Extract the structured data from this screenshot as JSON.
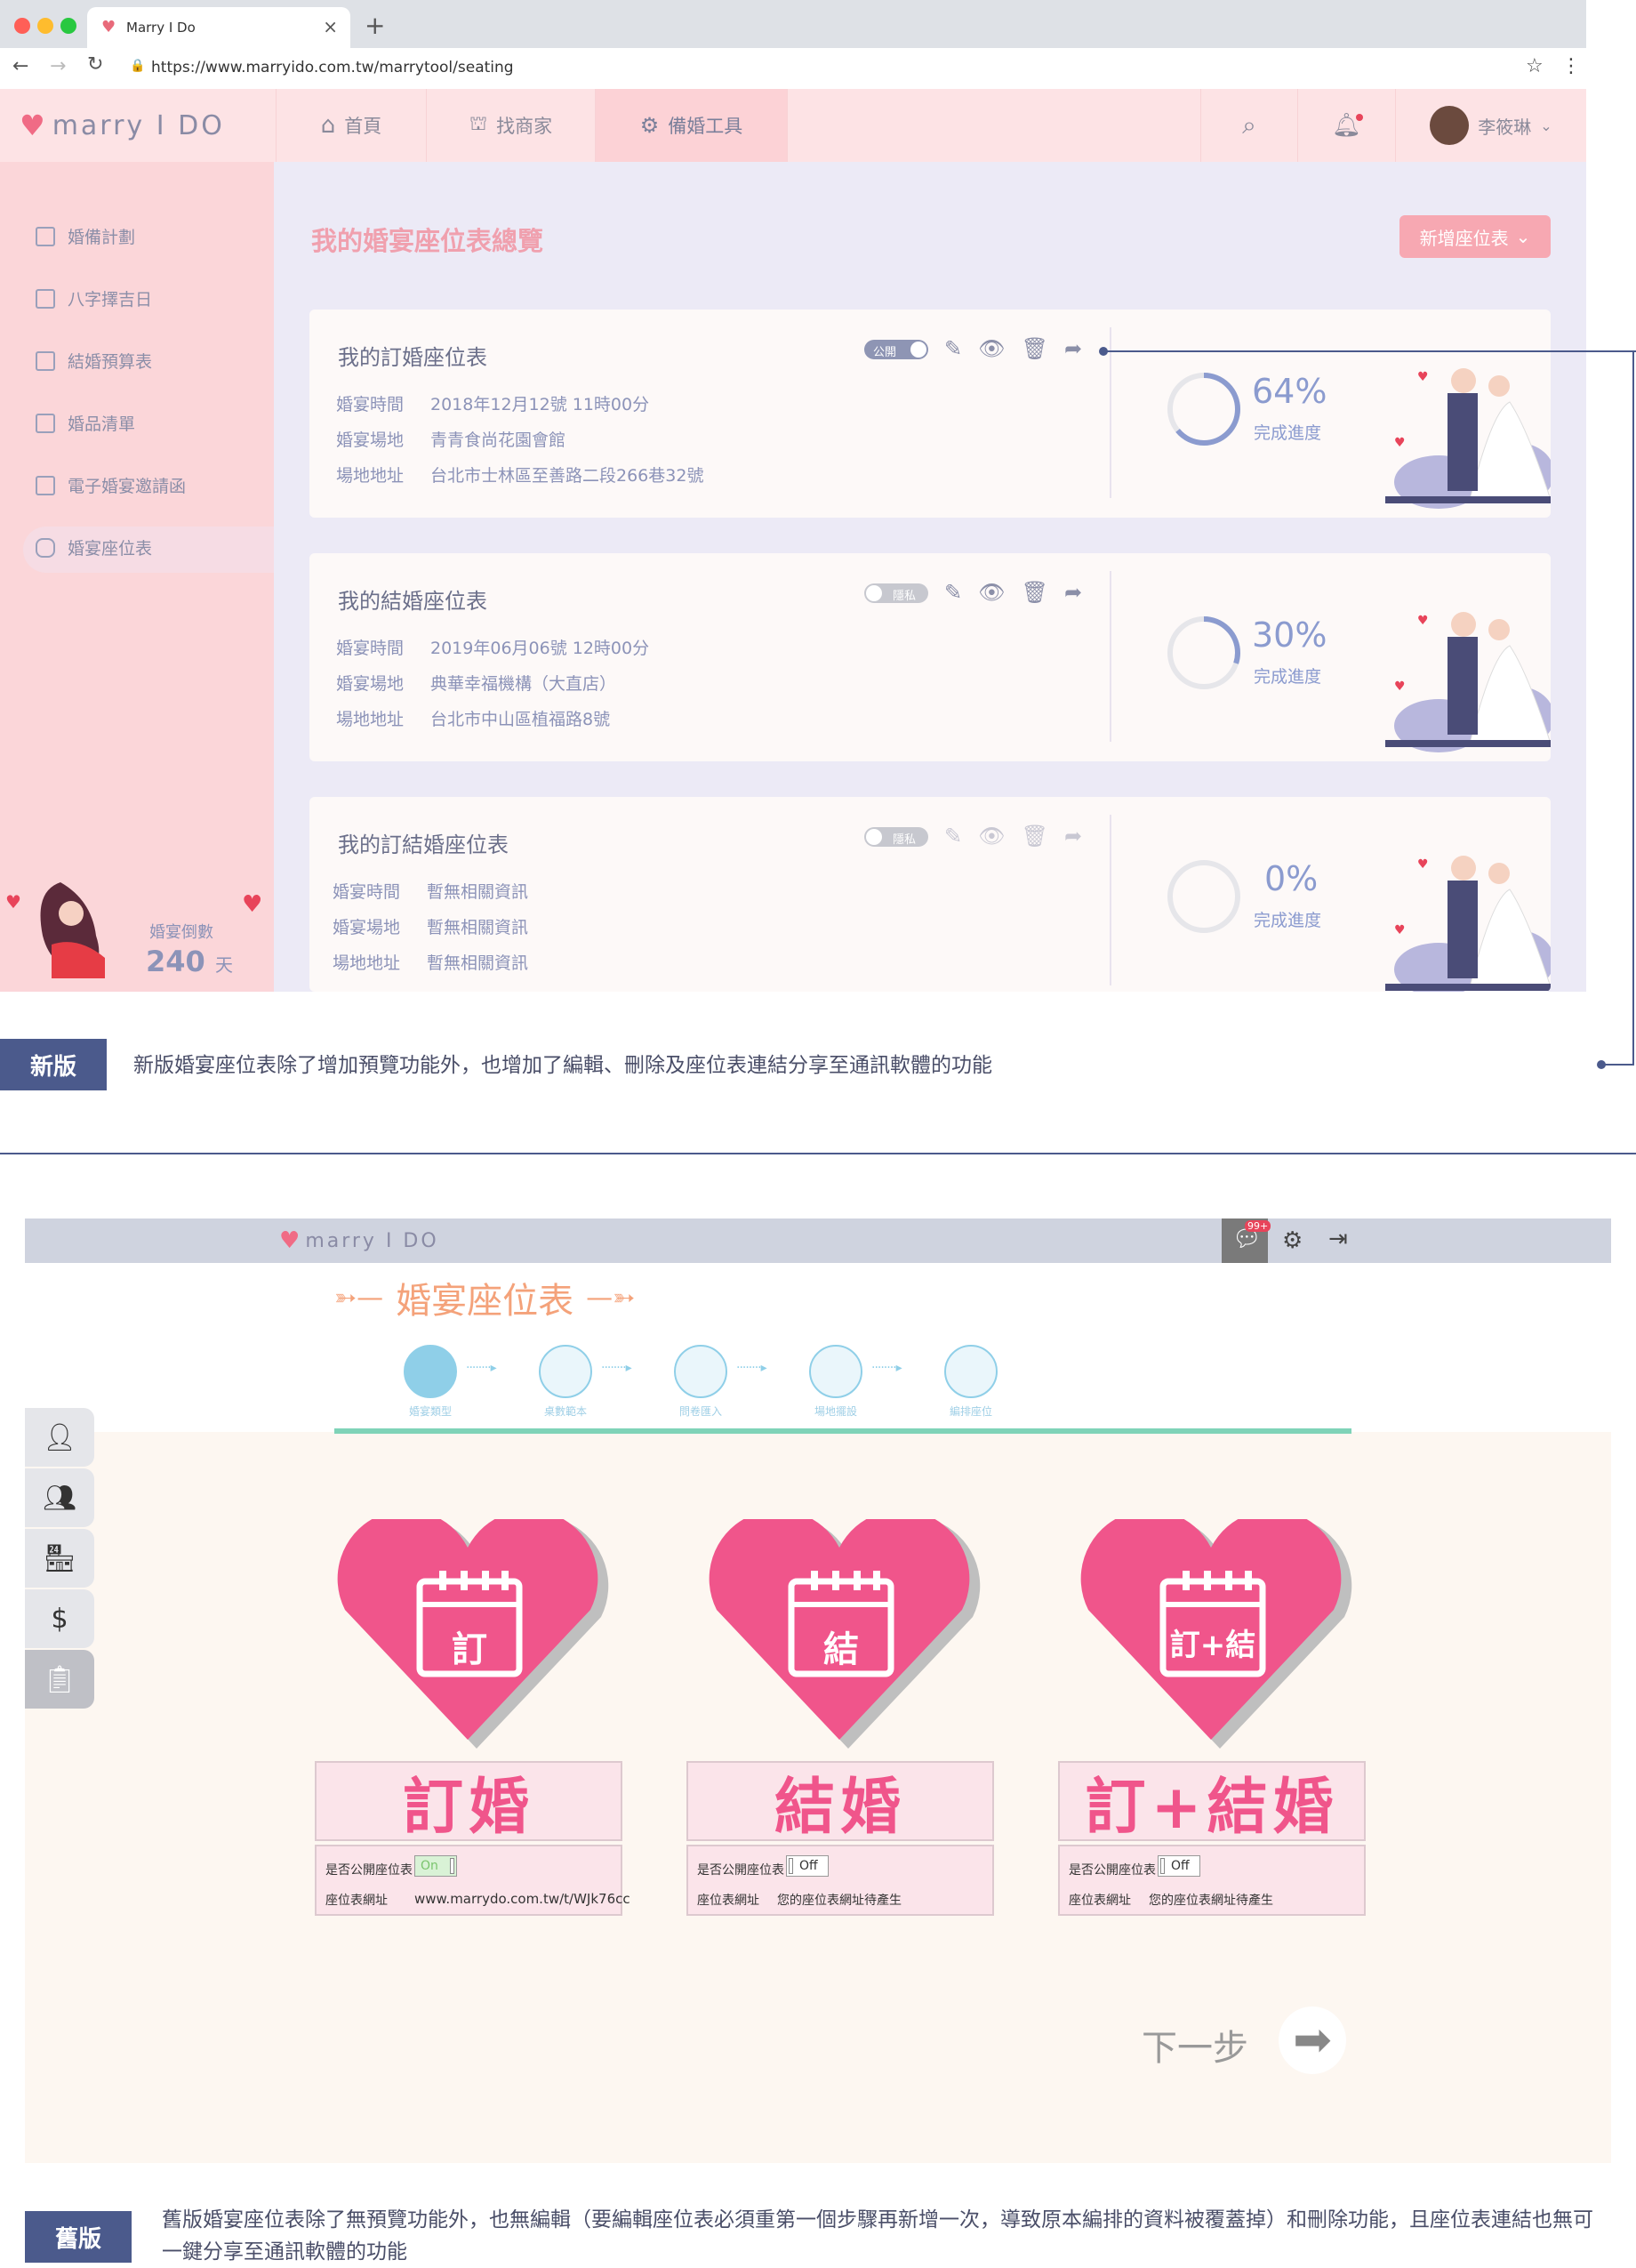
{
  "browser": {
    "tab_title": "Marry I Do",
    "url": "https://www.marryido.com.tw/marrytool/seating"
  },
  "header": {
    "logo": "marry I DO",
    "nav": [
      "首頁",
      "找商家",
      "備婚工具"
    ],
    "user": "李筱琳"
  },
  "sidebar": {
    "items": [
      "婚備計劃",
      "八字擇吉日",
      "結婚預算表",
      "婚品清單",
      "電子婚宴邀請函",
      "婚宴座位表"
    ],
    "countdown_label": "婚宴倒數",
    "countdown_value": "240",
    "countdown_unit": "天"
  },
  "main": {
    "title": "我的婚宴座位表總覽",
    "add_button": "新增座位表",
    "cards": [
      {
        "title": "我的訂婚座位表",
        "toggle": "公開",
        "rows": [
          [
            "婚宴時間",
            "2018年12月12號  11時00分"
          ],
          [
            "婚宴場地",
            "青青食尚花園會館"
          ],
          [
            "場地地址",
            "台北市士林區至善路二段266巷32號"
          ]
        ],
        "percent": "64%",
        "progress": 0.64,
        "progress_label": "完成進度"
      },
      {
        "title": "我的結婚座位表",
        "toggle": "隱私",
        "rows": [
          [
            "婚宴時間",
            "2019年06月06號  12時00分"
          ],
          [
            "婚宴場地",
            "典華幸福機構（大直店）"
          ],
          [
            "場地地址",
            "台北市中山區植福路8號"
          ]
        ],
        "percent": "30%",
        "progress": 0.3,
        "progress_label": "完成進度"
      },
      {
        "title": "我的訂結婚座位表",
        "toggle": "隱私",
        "rows": [
          [
            "婚宴時間",
            "暫無相關資訊"
          ],
          [
            "婚宴場地",
            "暫無相關資訊"
          ],
          [
            "場地地址",
            "暫無相關資訊"
          ]
        ],
        "percent": "0%",
        "progress": 0,
        "progress_label": "完成進度"
      }
    ]
  },
  "new_note": {
    "tag": "新版",
    "text": "新版婚宴座位表除了增加預覽功能外，也增加了編輯、刪除及座位表連結分享至通訊軟體的功能"
  },
  "old": {
    "logo": "marry I DO",
    "badge": "99+",
    "title": "婚宴座位表",
    "steps": [
      "婚宴類型",
      "桌數範本",
      "問卷匯入",
      "場地擺設",
      "編排座位"
    ],
    "options": [
      {
        "icon": "訂",
        "name": "訂婚",
        "public_label": "是否公開座位表",
        "toggle": "On",
        "url_label": "座位表網址",
        "url": "www.marrydo.com.tw/t/WJk76cc"
      },
      {
        "icon": "結",
        "name": "結婚",
        "public_label": "是否公開座位表",
        "toggle": "Off",
        "url_label": "座位表網址",
        "url": "您的座位表網址待產生"
      },
      {
        "icon": "訂+結",
        "name": "訂+結婚",
        "public_label": "是否公開座位表",
        "toggle": "Off",
        "url_label": "座位表網址",
        "url": "您的座位表網址待產生"
      }
    ],
    "next": "下一步"
  },
  "old_note": {
    "tag": "舊版",
    "text": "舊版婚宴座位表除了無預覽功能外，也無編輯（要編輯座位表必須重第一個步驟再新增一次，導致原本編排的資料被覆蓋掉）和刪除功能，且座位表連結也無可一鍵分享至通訊軟體的功能"
  }
}
